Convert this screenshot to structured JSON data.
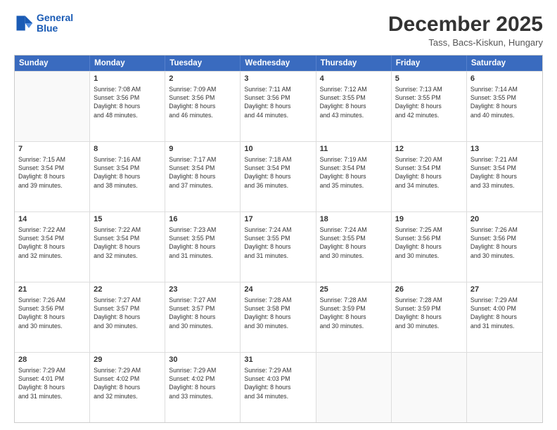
{
  "logo": {
    "line1": "General",
    "line2": "Blue"
  },
  "title": "December 2025",
  "subtitle": "Tass, Bacs-Kiskun, Hungary",
  "header_days": [
    "Sunday",
    "Monday",
    "Tuesday",
    "Wednesday",
    "Thursday",
    "Friday",
    "Saturday"
  ],
  "rows": [
    [
      {
        "day": "",
        "lines": []
      },
      {
        "day": "1",
        "lines": [
          "Sunrise: 7:08 AM",
          "Sunset: 3:56 PM",
          "Daylight: 8 hours",
          "and 48 minutes."
        ]
      },
      {
        "day": "2",
        "lines": [
          "Sunrise: 7:09 AM",
          "Sunset: 3:56 PM",
          "Daylight: 8 hours",
          "and 46 minutes."
        ]
      },
      {
        "day": "3",
        "lines": [
          "Sunrise: 7:11 AM",
          "Sunset: 3:56 PM",
          "Daylight: 8 hours",
          "and 44 minutes."
        ]
      },
      {
        "day": "4",
        "lines": [
          "Sunrise: 7:12 AM",
          "Sunset: 3:55 PM",
          "Daylight: 8 hours",
          "and 43 minutes."
        ]
      },
      {
        "day": "5",
        "lines": [
          "Sunrise: 7:13 AM",
          "Sunset: 3:55 PM",
          "Daylight: 8 hours",
          "and 42 minutes."
        ]
      },
      {
        "day": "6",
        "lines": [
          "Sunrise: 7:14 AM",
          "Sunset: 3:55 PM",
          "Daylight: 8 hours",
          "and 40 minutes."
        ]
      }
    ],
    [
      {
        "day": "7",
        "lines": [
          "Sunrise: 7:15 AM",
          "Sunset: 3:54 PM",
          "Daylight: 8 hours",
          "and 39 minutes."
        ]
      },
      {
        "day": "8",
        "lines": [
          "Sunrise: 7:16 AM",
          "Sunset: 3:54 PM",
          "Daylight: 8 hours",
          "and 38 minutes."
        ]
      },
      {
        "day": "9",
        "lines": [
          "Sunrise: 7:17 AM",
          "Sunset: 3:54 PM",
          "Daylight: 8 hours",
          "and 37 minutes."
        ]
      },
      {
        "day": "10",
        "lines": [
          "Sunrise: 7:18 AM",
          "Sunset: 3:54 PM",
          "Daylight: 8 hours",
          "and 36 minutes."
        ]
      },
      {
        "day": "11",
        "lines": [
          "Sunrise: 7:19 AM",
          "Sunset: 3:54 PM",
          "Daylight: 8 hours",
          "and 35 minutes."
        ]
      },
      {
        "day": "12",
        "lines": [
          "Sunrise: 7:20 AM",
          "Sunset: 3:54 PM",
          "Daylight: 8 hours",
          "and 34 minutes."
        ]
      },
      {
        "day": "13",
        "lines": [
          "Sunrise: 7:21 AM",
          "Sunset: 3:54 PM",
          "Daylight: 8 hours",
          "and 33 minutes."
        ]
      }
    ],
    [
      {
        "day": "14",
        "lines": [
          "Sunrise: 7:22 AM",
          "Sunset: 3:54 PM",
          "Daylight: 8 hours",
          "and 32 minutes."
        ]
      },
      {
        "day": "15",
        "lines": [
          "Sunrise: 7:22 AM",
          "Sunset: 3:54 PM",
          "Daylight: 8 hours",
          "and 32 minutes."
        ]
      },
      {
        "day": "16",
        "lines": [
          "Sunrise: 7:23 AM",
          "Sunset: 3:55 PM",
          "Daylight: 8 hours",
          "and 31 minutes."
        ]
      },
      {
        "day": "17",
        "lines": [
          "Sunrise: 7:24 AM",
          "Sunset: 3:55 PM",
          "Daylight: 8 hours",
          "and 31 minutes."
        ]
      },
      {
        "day": "18",
        "lines": [
          "Sunrise: 7:24 AM",
          "Sunset: 3:55 PM",
          "Daylight: 8 hours",
          "and 30 minutes."
        ]
      },
      {
        "day": "19",
        "lines": [
          "Sunrise: 7:25 AM",
          "Sunset: 3:56 PM",
          "Daylight: 8 hours",
          "and 30 minutes."
        ]
      },
      {
        "day": "20",
        "lines": [
          "Sunrise: 7:26 AM",
          "Sunset: 3:56 PM",
          "Daylight: 8 hours",
          "and 30 minutes."
        ]
      }
    ],
    [
      {
        "day": "21",
        "lines": [
          "Sunrise: 7:26 AM",
          "Sunset: 3:56 PM",
          "Daylight: 8 hours",
          "and 30 minutes."
        ]
      },
      {
        "day": "22",
        "lines": [
          "Sunrise: 7:27 AM",
          "Sunset: 3:57 PM",
          "Daylight: 8 hours",
          "and 30 minutes."
        ]
      },
      {
        "day": "23",
        "lines": [
          "Sunrise: 7:27 AM",
          "Sunset: 3:57 PM",
          "Daylight: 8 hours",
          "and 30 minutes."
        ]
      },
      {
        "day": "24",
        "lines": [
          "Sunrise: 7:28 AM",
          "Sunset: 3:58 PM",
          "Daylight: 8 hours",
          "and 30 minutes."
        ]
      },
      {
        "day": "25",
        "lines": [
          "Sunrise: 7:28 AM",
          "Sunset: 3:59 PM",
          "Daylight: 8 hours",
          "and 30 minutes."
        ]
      },
      {
        "day": "26",
        "lines": [
          "Sunrise: 7:28 AM",
          "Sunset: 3:59 PM",
          "Daylight: 8 hours",
          "and 30 minutes."
        ]
      },
      {
        "day": "27",
        "lines": [
          "Sunrise: 7:29 AM",
          "Sunset: 4:00 PM",
          "Daylight: 8 hours",
          "and 31 minutes."
        ]
      }
    ],
    [
      {
        "day": "28",
        "lines": [
          "Sunrise: 7:29 AM",
          "Sunset: 4:01 PM",
          "Daylight: 8 hours",
          "and 31 minutes."
        ]
      },
      {
        "day": "29",
        "lines": [
          "Sunrise: 7:29 AM",
          "Sunset: 4:02 PM",
          "Daylight: 8 hours",
          "and 32 minutes."
        ]
      },
      {
        "day": "30",
        "lines": [
          "Sunrise: 7:29 AM",
          "Sunset: 4:02 PM",
          "Daylight: 8 hours",
          "and 33 minutes."
        ]
      },
      {
        "day": "31",
        "lines": [
          "Sunrise: 7:29 AM",
          "Sunset: 4:03 PM",
          "Daylight: 8 hours",
          "and 34 minutes."
        ]
      },
      {
        "day": "",
        "lines": []
      },
      {
        "day": "",
        "lines": []
      },
      {
        "day": "",
        "lines": []
      }
    ]
  ]
}
